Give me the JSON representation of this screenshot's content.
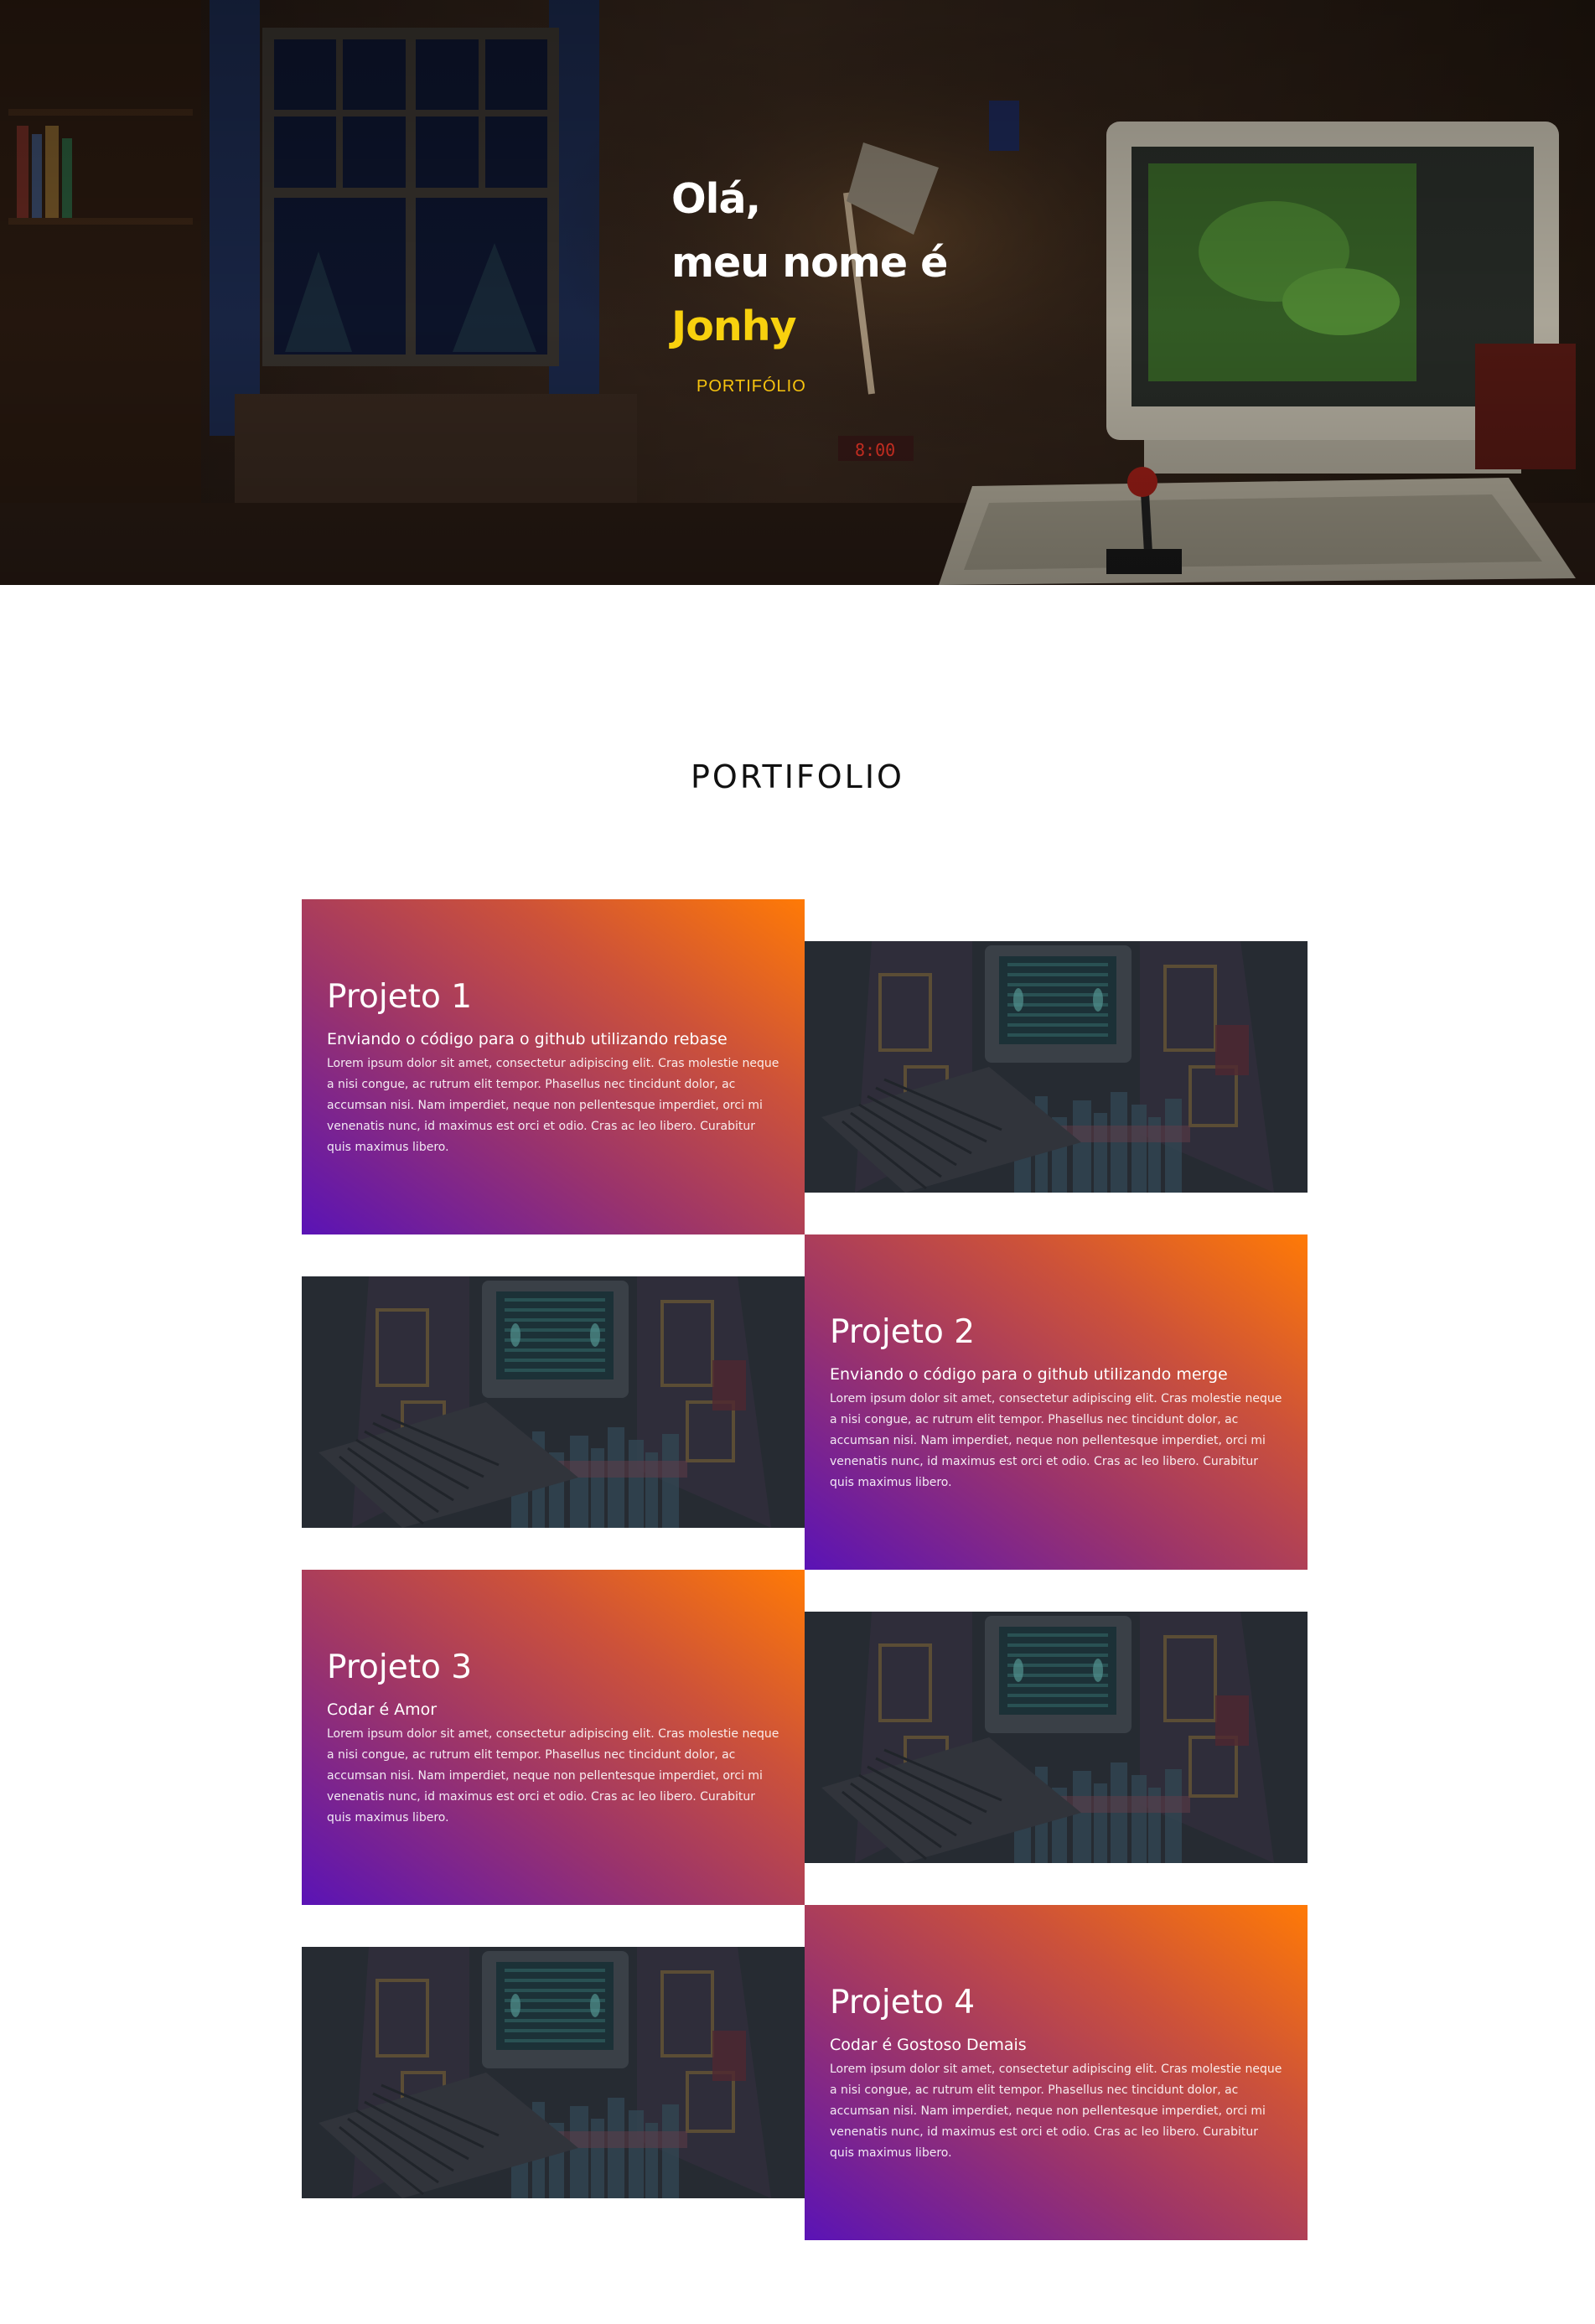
{
  "hero": {
    "greeting": "Olá,",
    "intro": "meu nome é",
    "name": "Jonhy",
    "link_label": "PORTIFÓLIO"
  },
  "portfolio": {
    "title": "PORTIFOLIO",
    "projects": [
      {
        "title": "Projeto 1",
        "subtitle": "Enviando o código para o github utilizando rebase",
        "text": "Lorem ipsum dolor sit amet, consectetur adipiscing elit. Cras molestie neque a nisi congue, ac rutrum elit tempor. Phasellus nec tincidunt dolor, ac accumsan nisi. Nam imperdiet, neque non pellentesque imperdiet, orci mi venenatis nunc, id maximus est orci et odio. Cras ac leo libero. Curabitur quis maximus libero."
      },
      {
        "title": "Projeto 2",
        "subtitle": "Enviando o código para o github utilizando merge",
        "text": "Lorem ipsum dolor sit amet, consectetur adipiscing elit. Cras molestie neque a nisi congue, ac rutrum elit tempor. Phasellus nec tincidunt dolor, ac accumsan nisi. Nam imperdiet, neque non pellentesque imperdiet, orci mi venenatis nunc, id maximus est orci et odio. Cras ac leo libero. Curabitur quis maximus libero."
      },
      {
        "title": "Projeto 3",
        "subtitle": "Codar é Amor",
        "text": "Lorem ipsum dolor sit amet, consectetur adipiscing elit. Cras molestie neque a nisi congue, ac rutrum elit tempor. Phasellus nec tincidunt dolor, ac accumsan nisi. Nam imperdiet, neque non pellentesque imperdiet, orci mi venenatis nunc, id maximus est orci et odio. Cras ac leo libero. Curabitur quis maximus libero."
      },
      {
        "title": "Projeto 4",
        "subtitle": "Codar é Gostoso Demais",
        "text": "Lorem ipsum dolor sit amet, consectetur adipiscing elit. Cras molestie neque a nisi congue, ac rutrum elit tempor. Phasellus nec tincidunt dolor, ac accumsan nisi. Nam imperdiet, neque non pellentesque imperdiet, orci mi venenatis nunc, id maximus est orci et odio. Cras ac leo libero. Curabitur quis maximus libero."
      }
    ]
  },
  "colors": {
    "accent_yellow": "#f8d10e",
    "gradient_start": "#5a13b6",
    "gradient_end": "#ff7a06"
  }
}
